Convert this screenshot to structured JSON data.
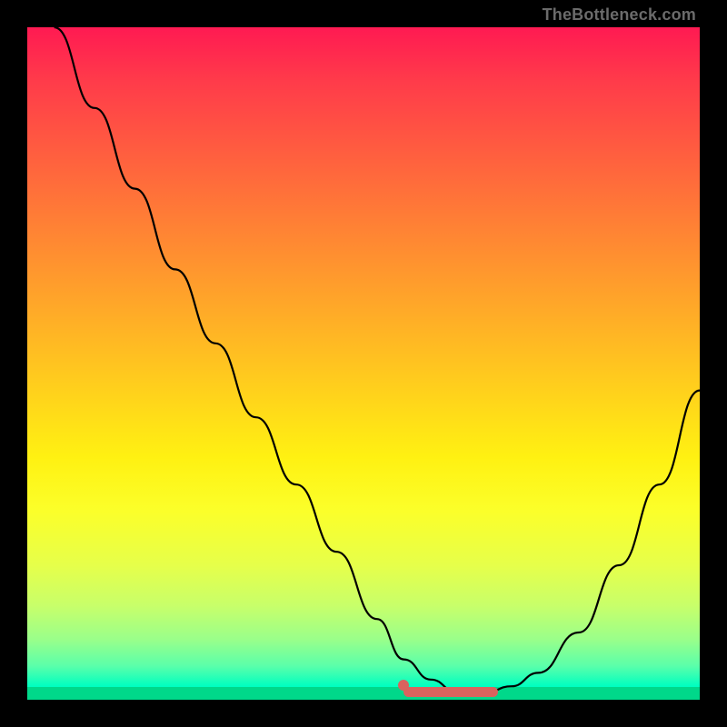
{
  "watermark": "TheBottleneck.com",
  "chart_data": {
    "type": "line",
    "title": "",
    "xlabel": "",
    "ylabel": "",
    "xlim": [
      0,
      100
    ],
    "ylim": [
      0,
      100
    ],
    "grid": false,
    "background_gradient": {
      "top": "#ff1a52",
      "middle": "#ffd71a",
      "bottom": "#00ffc0"
    },
    "series": [
      {
        "name": "bottleneck-curve",
        "x": [
          4,
          10,
          16,
          22,
          28,
          34,
          40,
          46,
          52,
          56,
          60,
          64,
          68,
          72,
          76,
          82,
          88,
          94,
          100
        ],
        "y": [
          100,
          88,
          76,
          64,
          53,
          42,
          32,
          22,
          12,
          6,
          3,
          1,
          1,
          2,
          4,
          10,
          20,
          32,
          46
        ],
        "color": "#000000",
        "stroke_width": 2
      }
    ],
    "highlight_segment": {
      "name": "optimal-range",
      "x_start": 56,
      "x_end": 70,
      "y": 1.2,
      "color": "#d9635e",
      "end_dot": {
        "x": 56,
        "y": 2.2
      }
    }
  }
}
